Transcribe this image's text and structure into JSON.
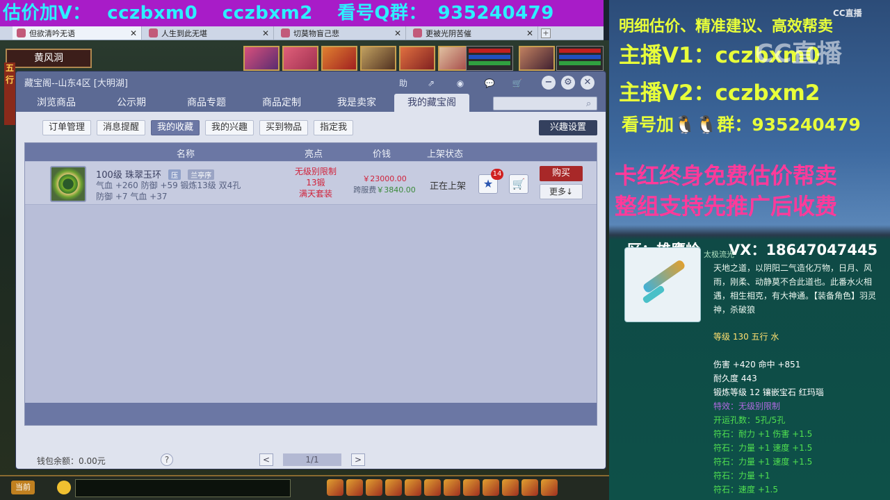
{
  "banner": {
    "seg1": "估价加V：",
    "seg2": "cczbxm0",
    "seg3": "cczbxm2",
    "seg4": "看号Q群：",
    "seg5": "935240479"
  },
  "browser_tabs": [
    {
      "label": "但欲清吟无语"
    },
    {
      "label": "人生到此无堪"
    },
    {
      "label": "切莫物盲己悲"
    },
    {
      "label": "更被光阴苦催"
    }
  ],
  "scene": {
    "location": "黄风洞",
    "left_edge": "五行"
  },
  "dialog": {
    "title": "藏宝阁--山东4区 [大明湖]",
    "toolbar": {
      "help": "助"
    },
    "nav_tabs": [
      "浏览商品",
      "公示期",
      "商品专题",
      "商品定制",
      "我是卖家",
      "我的藏宝阁"
    ],
    "active_nav": "我的藏宝阁",
    "search": {
      "value": "",
      "placeholder": ""
    },
    "sub_tabs": [
      "订单管理",
      "消息提醒",
      "我的收藏",
      "我的兴趣",
      "买到物品",
      "指定我"
    ],
    "interest_button": "兴趣设置",
    "table": {
      "headers": [
        "名称",
        "亮点",
        "价钱",
        "上架状态"
      ],
      "rows": [
        {
          "name": "100级 珠翠玉环",
          "badge1": "压",
          "badge2": "兰亭序",
          "stat1": "气血 +260 防御 +59 锻炼13级 双4孔",
          "stat2": "防御 +7 气血 +37",
          "highlight1": "无级别限制",
          "highlight2": "13锻",
          "highlight3": "满天套装",
          "price": "￥23000.00",
          "fee_label": "跨服费",
          "fee_value": "￥3840.00",
          "status": "正在上架",
          "star_count": "14",
          "buy": "购买",
          "more": "更多"
        }
      ]
    },
    "wallet": "钱包余额：0.00元",
    "help": "?",
    "pagination": {
      "prev": "<",
      "page": "1/1",
      "next": ">"
    }
  },
  "gamebar": {
    "channel": "当前"
  },
  "right_panel": {
    "line1": "明细估价、精准建议、高效帮卖",
    "watermark": "CC直播",
    "line2": "主播V1：cczbxm0",
    "cc_logo": "CC直播",
    "line3": "主播V2：cczbxm2",
    "line4": "看号加🐧🐧群：935240479",
    "promo1": "卡红终身免费估价帮卖",
    "promo2": "整组支持先推广后收费",
    "server": "区：雄鹰岭",
    "vx": "VX：18647047445"
  },
  "tooltip": {
    "small_title": "太极流光",
    "desc": "天地之道，以阴阳二气造化万物，日月、风雨，刚柔、动静莫不合此道也。此番水火相遇，相生相克，有大神通。【装备角色】羽灵神，杀破狼",
    "level": "等级 130 五行 水",
    "lines": [
      {
        "text": "伤害 +420 命中 +851",
        "color": "#ffffff"
      },
      {
        "text": "耐久度 443",
        "color": "#ffffff"
      },
      {
        "text": "锻炼等级 12 镶嵌宝石 红玛瑙",
        "color": "#ffffff"
      },
      {
        "text": "特效：无级别限制",
        "color": "#b06ae0"
      },
      {
        "text": "开运孔数：5孔/5孔",
        "color": "#50e050"
      },
      {
        "text": "符石：耐力 +1 伤害 +1.5",
        "color": "#50e050"
      },
      {
        "text": "符石：力量 +1 速度 +1.5",
        "color": "#50e050"
      },
      {
        "text": "符石：力量 +1 速度 +1.5",
        "color": "#50e050"
      },
      {
        "text": "符石：力量 +1",
        "color": "#50e050"
      },
      {
        "text": "符石：速度 +1.5",
        "color": "#50e050"
      }
    ]
  },
  "colors": {
    "banner_bg": "#a81cc8",
    "banner_text": "#2cf0ff",
    "dialog_header": "#5c6a94",
    "buy_button": "#a82828",
    "promo_text": "#ff3a9a",
    "overlay_text": "#e8ff3a"
  }
}
